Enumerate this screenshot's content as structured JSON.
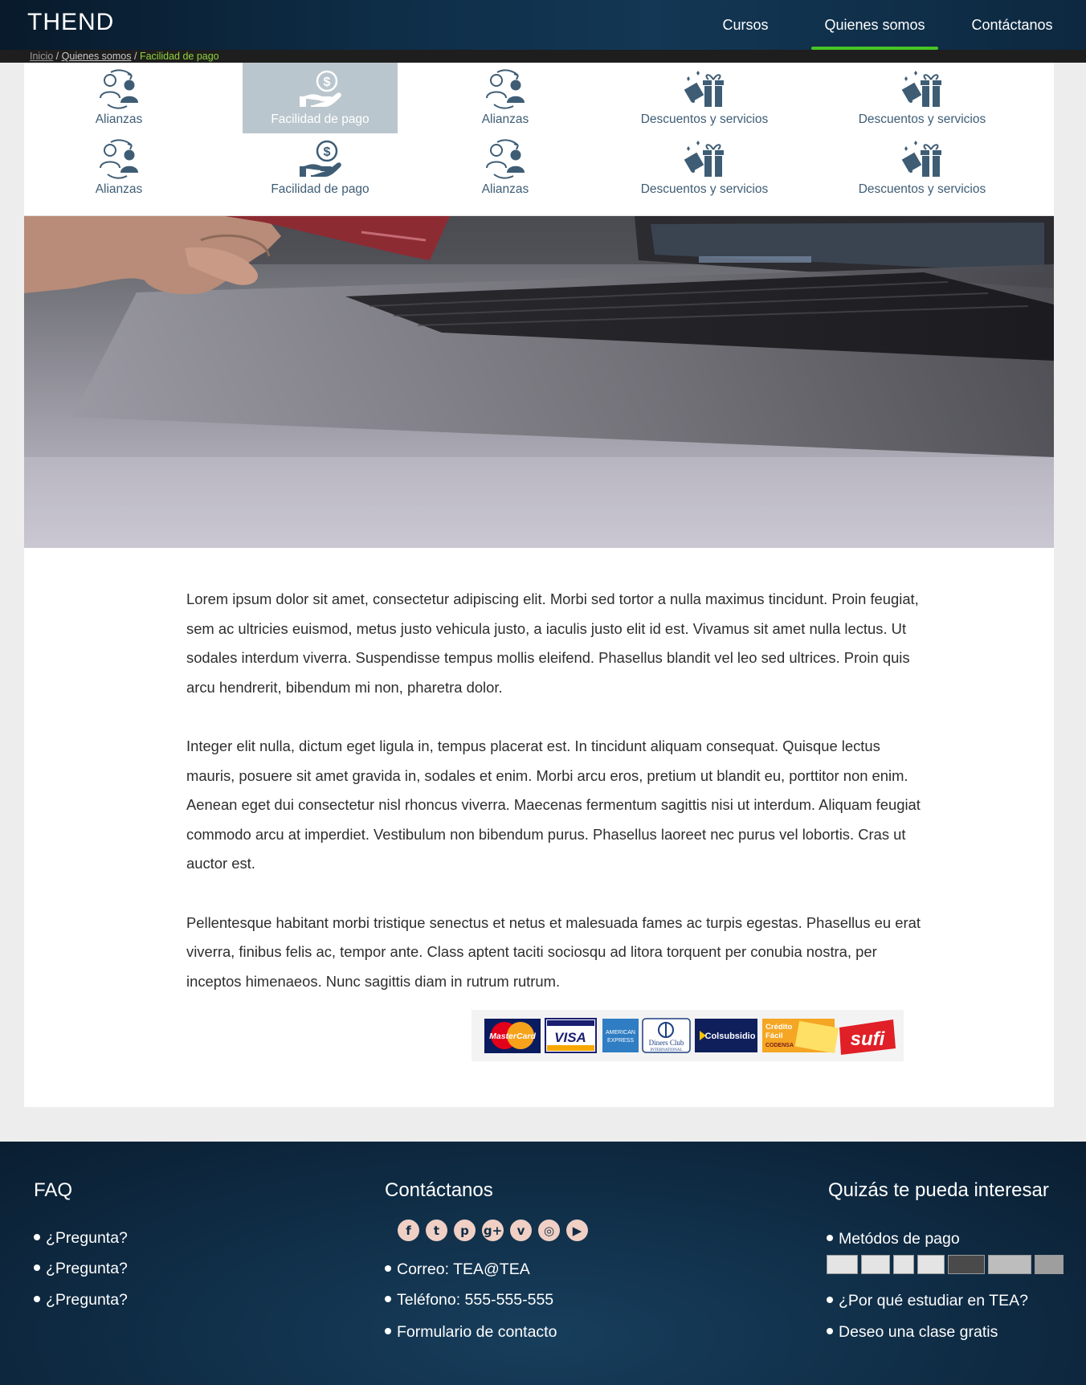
{
  "header": {
    "logo_text": "THEND",
    "nav": [
      {
        "label": "Cursos"
      },
      {
        "label": "Quienes somos"
      },
      {
        "label": "Contáctanos"
      }
    ]
  },
  "breadcrumb": {
    "home": "Inicio",
    "sep": "/",
    "section": "Quienes somos",
    "current": "Facilidad de pago"
  },
  "tiles": [
    {
      "label": "Alianzas",
      "icon": "alliance-icon"
    },
    {
      "label": "Facilidad de pago",
      "icon": "payment-icon",
      "active": true
    },
    {
      "label": "Alianzas",
      "icon": "alliance-icon"
    },
    {
      "label": "Descuentos y servicios",
      "icon": "gift-icon"
    },
    {
      "label": "Descuentos y servicios",
      "icon": "gift-icon"
    },
    {
      "label": "Alianzas",
      "icon": "alliance-icon"
    },
    {
      "label": "Facilidad de pago",
      "icon": "payment-icon"
    },
    {
      "label": "Alianzas",
      "icon": "alliance-icon"
    },
    {
      "label": "Descuentos y servicios",
      "icon": "gift-icon"
    },
    {
      "label": "Descuentos y servicios",
      "icon": "gift-icon"
    }
  ],
  "article": {
    "paragraphs": [
      "Lorem ipsum dolor sit amet, consectetur adipiscing elit. Morbi sed tortor a nulla maximus tincidunt. Proin feugiat, sem ac ultricies euismod, metus justo vehicula justo, a iaculis justo elit id est. Vivamus sit amet nulla lectus. Ut sodales interdum viverra. Suspendisse tempus mollis eleifend. Phasellus blandit vel leo sed ultrices. Proin quis arcu hendrerit, bibendum mi non, pharetra dolor.",
      "Integer elit nulla, dictum eget ligula in, tempus placerat est. In tincidunt aliquam consequat. Quisque lectus mauris, posuere sit amet gravida in, sodales et enim. Morbi arcu eros, pretium ut blandit eu, porttitor non enim. Aenean eget dui consectetur nisl rhoncus viverra. Maecenas fermentum sagittis nisi ut interdum. Aliquam feugiat commodo arcu at imperdiet. Vestibulum non bibendum purus. Phasellus laoreet nec purus vel lobortis. Cras ut auctor est.",
      "Pellentesque habitant morbi tristique senectus et netus et malesuada fames ac turpis egestas. Phasellus eu erat viverra, finibus felis ac, tempor ante. Class aptent taciti sociosqu ad litora torquent per conubia nostra, per inceptos himenaeos. Nunc sagittis diam in rutrum rutrum."
    ]
  },
  "payment_logos": {
    "mastercard": "MasterCard",
    "visa": "VISA",
    "amex_1": "AMERICAN",
    "amex_2": "EXPRESS",
    "diners_1": "Diners Club",
    "diners_2": "INTERNATIONAL",
    "colsubsidio": "Colsubsidio",
    "codensa_1": "Crédito",
    "codensa_2": "Fácil",
    "codensa_3": "CODENSA",
    "sufi": "sufi"
  },
  "footer": {
    "faq": {
      "title": "FAQ",
      "items": [
        "¿Pregunta?",
        "¿Pregunta?",
        "¿Pregunta?"
      ]
    },
    "contact": {
      "title": "Contáctanos",
      "social": [
        {
          "icon": "facebook-icon",
          "glyph": "f"
        },
        {
          "icon": "twitter-icon",
          "glyph": "t"
        },
        {
          "icon": "pinterest-icon",
          "glyph": "p"
        },
        {
          "icon": "google-plus-icon",
          "glyph": "g+"
        },
        {
          "icon": "vimeo-icon",
          "glyph": "v"
        },
        {
          "icon": "instagram-icon",
          "glyph": "◎"
        },
        {
          "icon": "youtube-icon",
          "glyph": "▶"
        }
      ],
      "items": [
        "Correo: TEA@TEA",
        "Teléfono: 555-555-555",
        "Formulario de contacto"
      ]
    },
    "interest": {
      "title": "Quizás te pueda interesar",
      "items": [
        "Metódos de pago",
        "¿Por qué estudiar en TEA?",
        "Deseo una clase gratis"
      ]
    }
  },
  "colors": {
    "accent_green": "#48c524",
    "tile_text": "#3e5d75",
    "breadcrumb_current": "#8fd43a"
  }
}
